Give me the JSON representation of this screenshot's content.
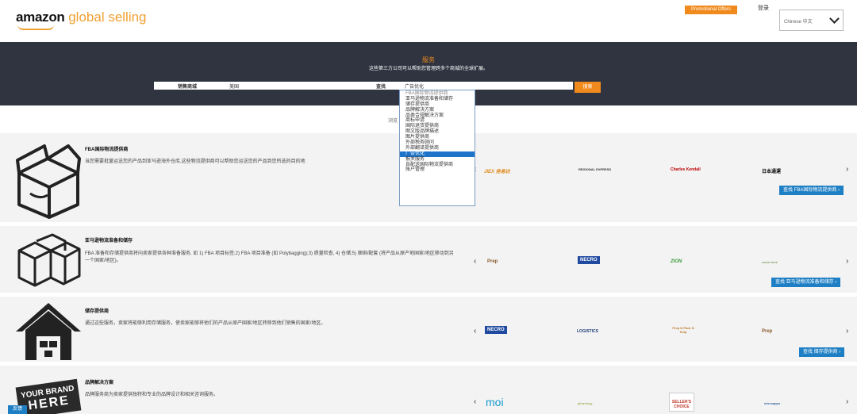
{
  "header": {
    "logo_bold": "amazon",
    "logo_light": " global selling",
    "promo_label": "Promotional Offers",
    "login_label": "登录",
    "language_value": "Chinese 中文"
  },
  "hero": {
    "title": "服务",
    "subtitle": "这些第三方公司可以帮助您管理跨多个商城的全球扩展。"
  },
  "filter": {
    "marketplace_label": "销售商城",
    "marketplace_value": "美国",
    "find_label": "查找",
    "find_value": "广告优化",
    "search_button": "搜索",
    "options": [
      "FBA国际物流提供商",
      "亚马逊物流准备和储存",
      "储存提供商",
      "品牌解决方案",
      "品类合规解决方案",
      "商标申请",
      "国际退货提供商",
      "图文版品牌描述",
      "图片提供商",
      "外部税务顾问",
      "外部翻译提供商",
      "广告优化",
      "报关服务",
      "自配送国际物流提供商",
      "账户管理"
    ],
    "selected_index": 11
  },
  "browse_text": "浏览",
  "sections": [
    {
      "title": "FBA国际物流提供商",
      "desc": "当您需要批量运送您的产品到亚马逊海外仓库,这些物流提供商可以帮助您运送您的产品到您所选的目的地",
      "partners": [
        "JIEX 佳易达",
        "REGIONAL EXPRESS",
        "Charles Kendall",
        "日本通運"
      ],
      "button": "查找 FBA国际物流提供商 ›"
    },
    {
      "title": "亚马逊物流准备和储存",
      "desc": "FBA 准备和存储提供商将向卖家提供各种准备服务, 如 1) FBA 项目标签;2) FBA 项目准备 (如 Polybagging);3) 质量检查, 4) 仓储;5) 捆绑/配套 (将产品从原产地国家/地区移动到另一个国家/地区)。",
      "partners": [
        "Prep",
        "NECRO",
        "ZION",
        "name store"
      ],
      "button": "查找 亚马逊物流准备和储存 ›"
    },
    {
      "title": "储存提供商",
      "desc": "通过这些服务，卖家将能够利用存储服务，使卖家能够将他们的产品从原产国家/地区转移到他们销售的国家/地区。",
      "partners": [
        "NECRO",
        "LOGISTICS",
        "Prep N Pack N Ship",
        "Prep"
      ],
      "button": "查找 储存提供商 ›"
    },
    {
      "title": "品牌解决方案",
      "desc": "品牌服务商为卖家提供独特和专业的品牌设计和相关咨询服务。",
      "partners": [
        "moi",
        "gfcarology",
        "SELLER'S CHOICE",
        "microapps"
      ],
      "button": ""
    }
  ],
  "brand_image_text": [
    "YOUR BRAND",
    "HERE"
  ],
  "feedback_label": "反馈",
  "arrows": {
    "left": "‹",
    "right": "›"
  }
}
